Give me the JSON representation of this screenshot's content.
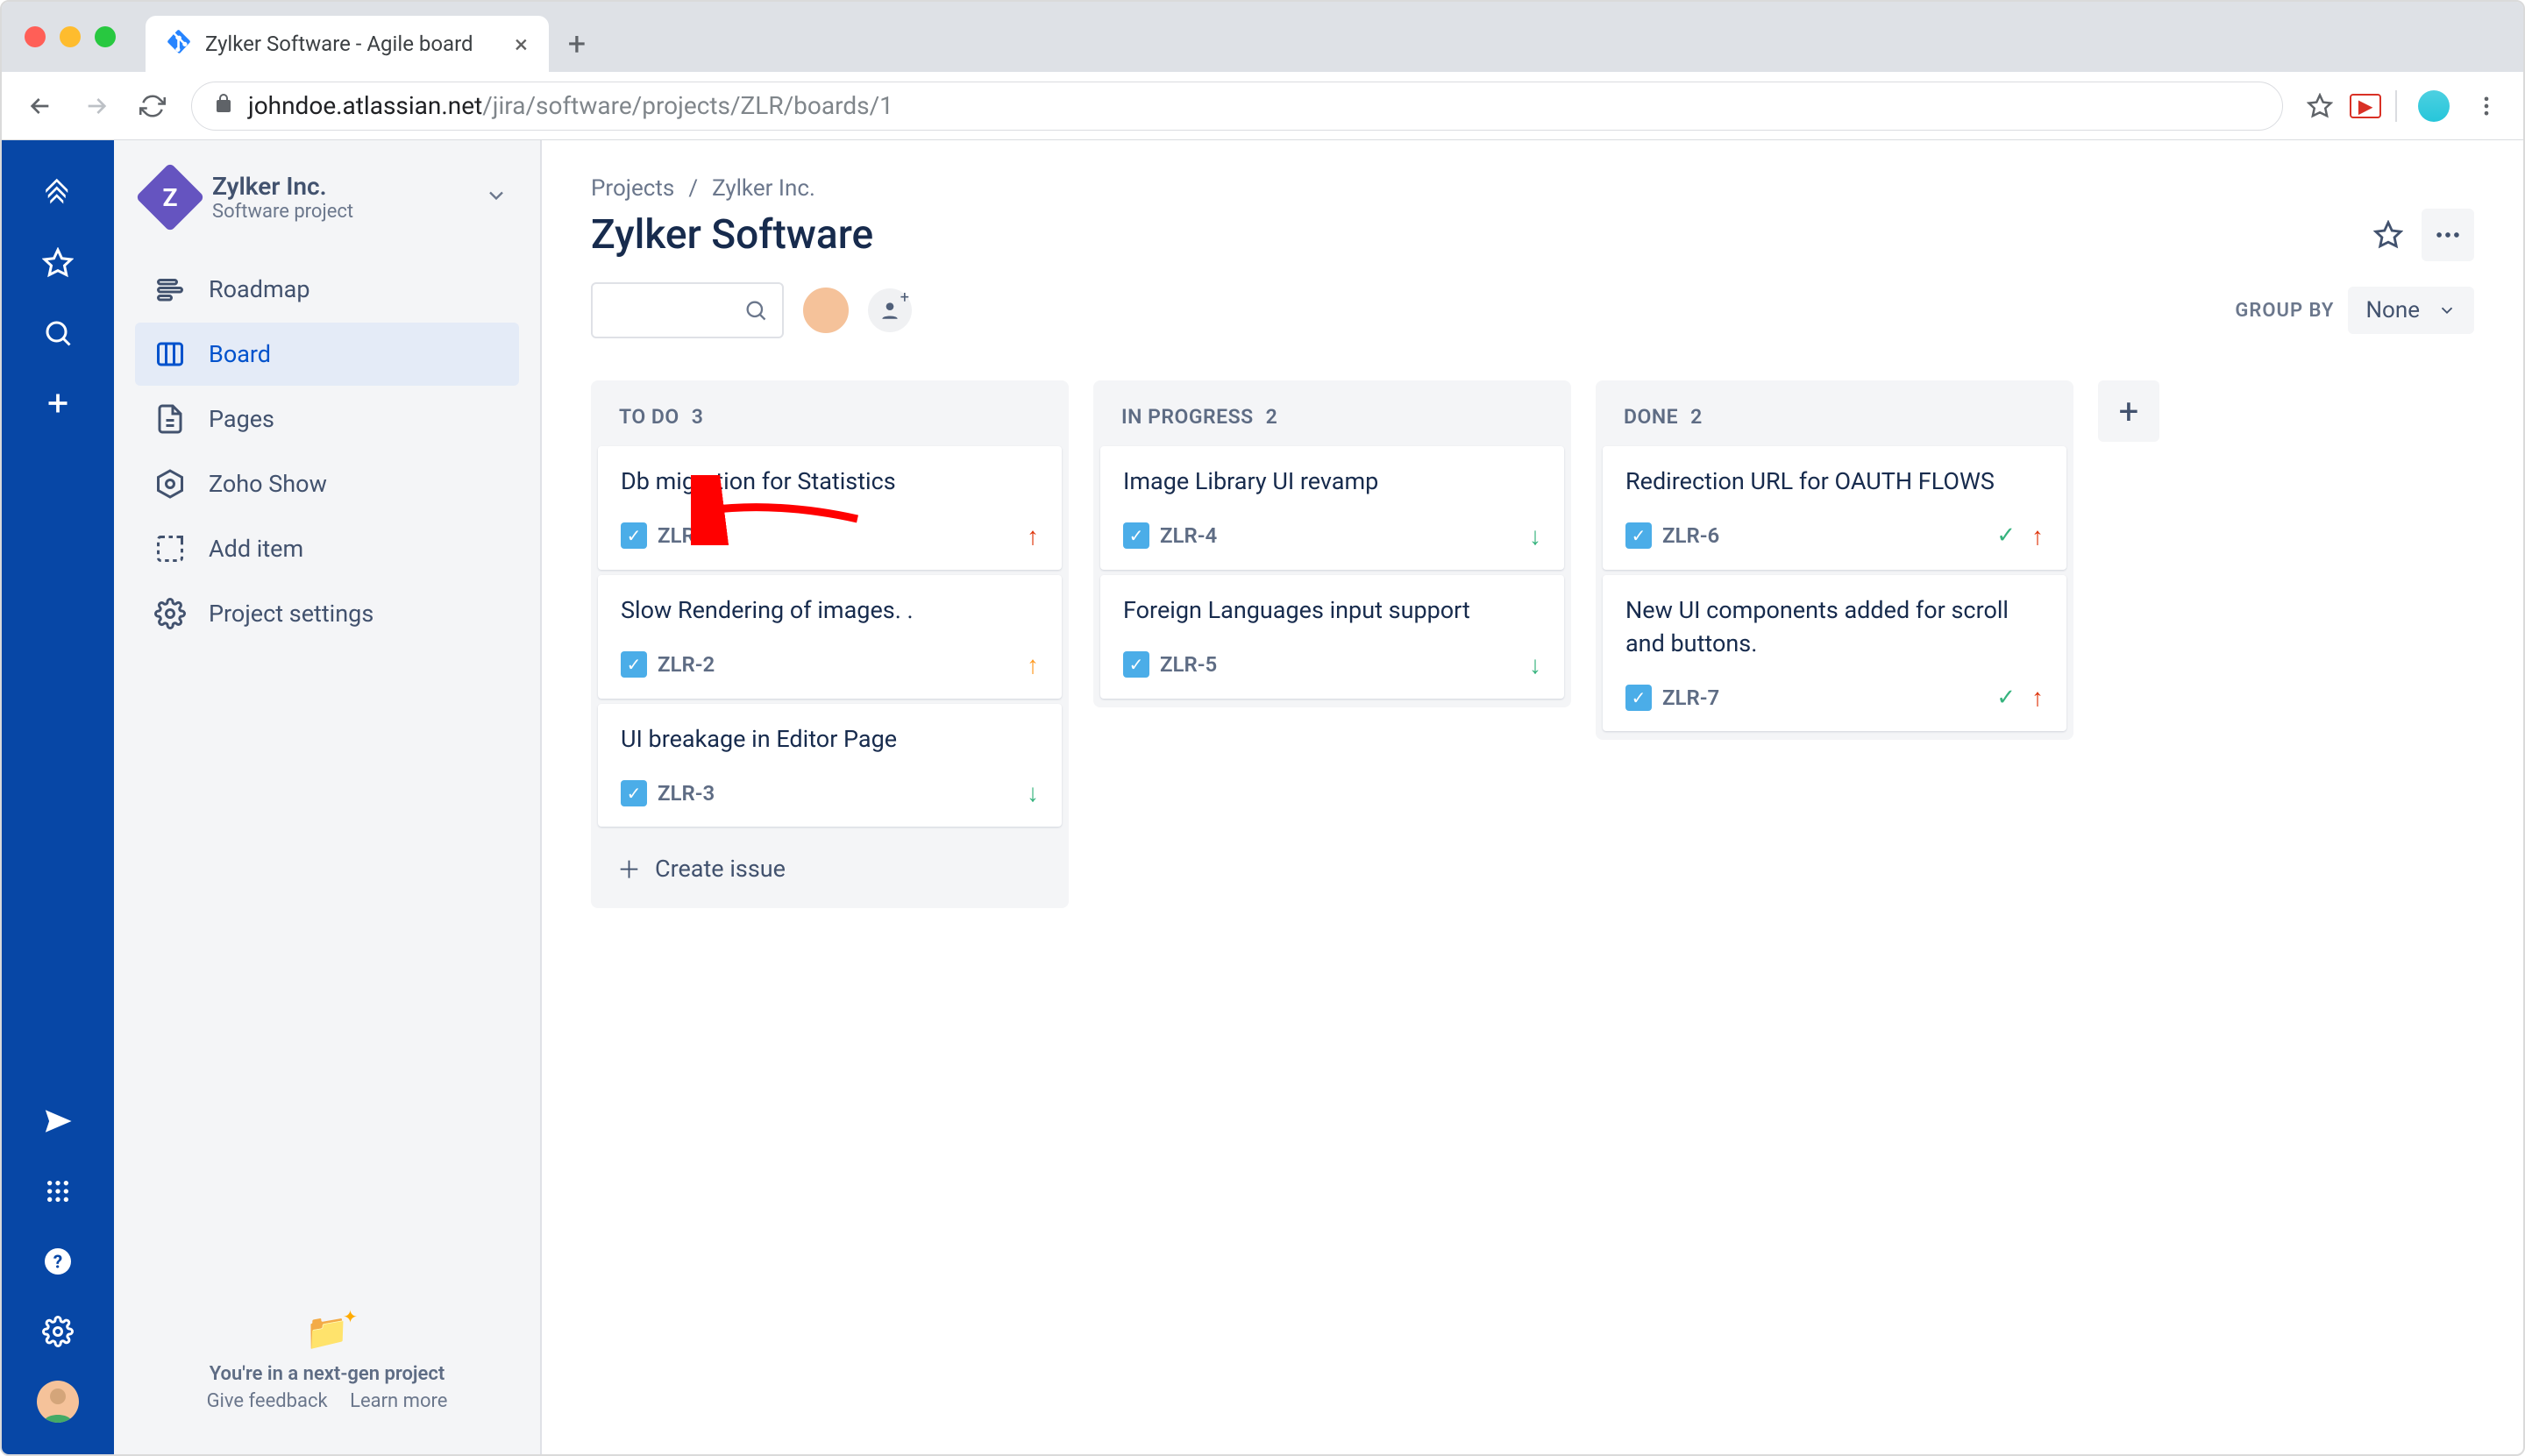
{
  "browser": {
    "tab_title": "Zylker Software - Agile board",
    "url_host": "johndoe.atlassian.net",
    "url_path": "/jira/software/projects/ZLR/boards/1"
  },
  "project": {
    "name": "Zylker Inc.",
    "subtitle": "Software project"
  },
  "sidebar": {
    "items": [
      {
        "label": "Roadmap",
        "icon": "roadmap"
      },
      {
        "label": "Board",
        "icon": "board",
        "active": true
      },
      {
        "label": "Pages",
        "icon": "pages"
      },
      {
        "label": "Zoho Show",
        "icon": "zoho"
      },
      {
        "label": "Add item",
        "icon": "add"
      },
      {
        "label": "Project settings",
        "icon": "settings"
      }
    ],
    "footer_line": "You're in a next-gen project",
    "footer_feedback": "Give feedback",
    "footer_learn": "Learn more"
  },
  "breadcrumbs": {
    "root": "Projects",
    "current": "Zylker Inc."
  },
  "page_title": "Zylker Software",
  "groupby": {
    "label": "GROUP BY",
    "value": "None"
  },
  "columns": [
    {
      "title": "TO DO",
      "count": "3",
      "cards": [
        {
          "title": "Db migration for Statistics",
          "key": "ZLR-1",
          "priority": "highest",
          "done": false
        },
        {
          "title": "Slow Rendering of images. .",
          "key": "ZLR-2",
          "priority": "medium",
          "done": false
        },
        {
          "title": "UI breakage in Editor Page",
          "key": "ZLR-3",
          "priority": "low",
          "done": false
        }
      ],
      "create_label": "Create issue",
      "show_create": true
    },
    {
      "title": "IN PROGRESS",
      "count": "2",
      "cards": [
        {
          "title": "Image Library UI revamp",
          "key": "ZLR-4",
          "priority": "low",
          "done": false
        },
        {
          "title": "Foreign Languages input support",
          "key": "ZLR-5",
          "priority": "low",
          "done": false
        }
      ]
    },
    {
      "title": "DONE",
      "count": "2",
      "cards": [
        {
          "title": "Redirection URL for OAUTH FLOWS",
          "key": "ZLR-6",
          "priority": "highest",
          "done": true
        },
        {
          "title": "New UI components added for scroll and buttons.",
          "key": "ZLR-7",
          "priority": "highest",
          "done": true
        }
      ]
    }
  ]
}
